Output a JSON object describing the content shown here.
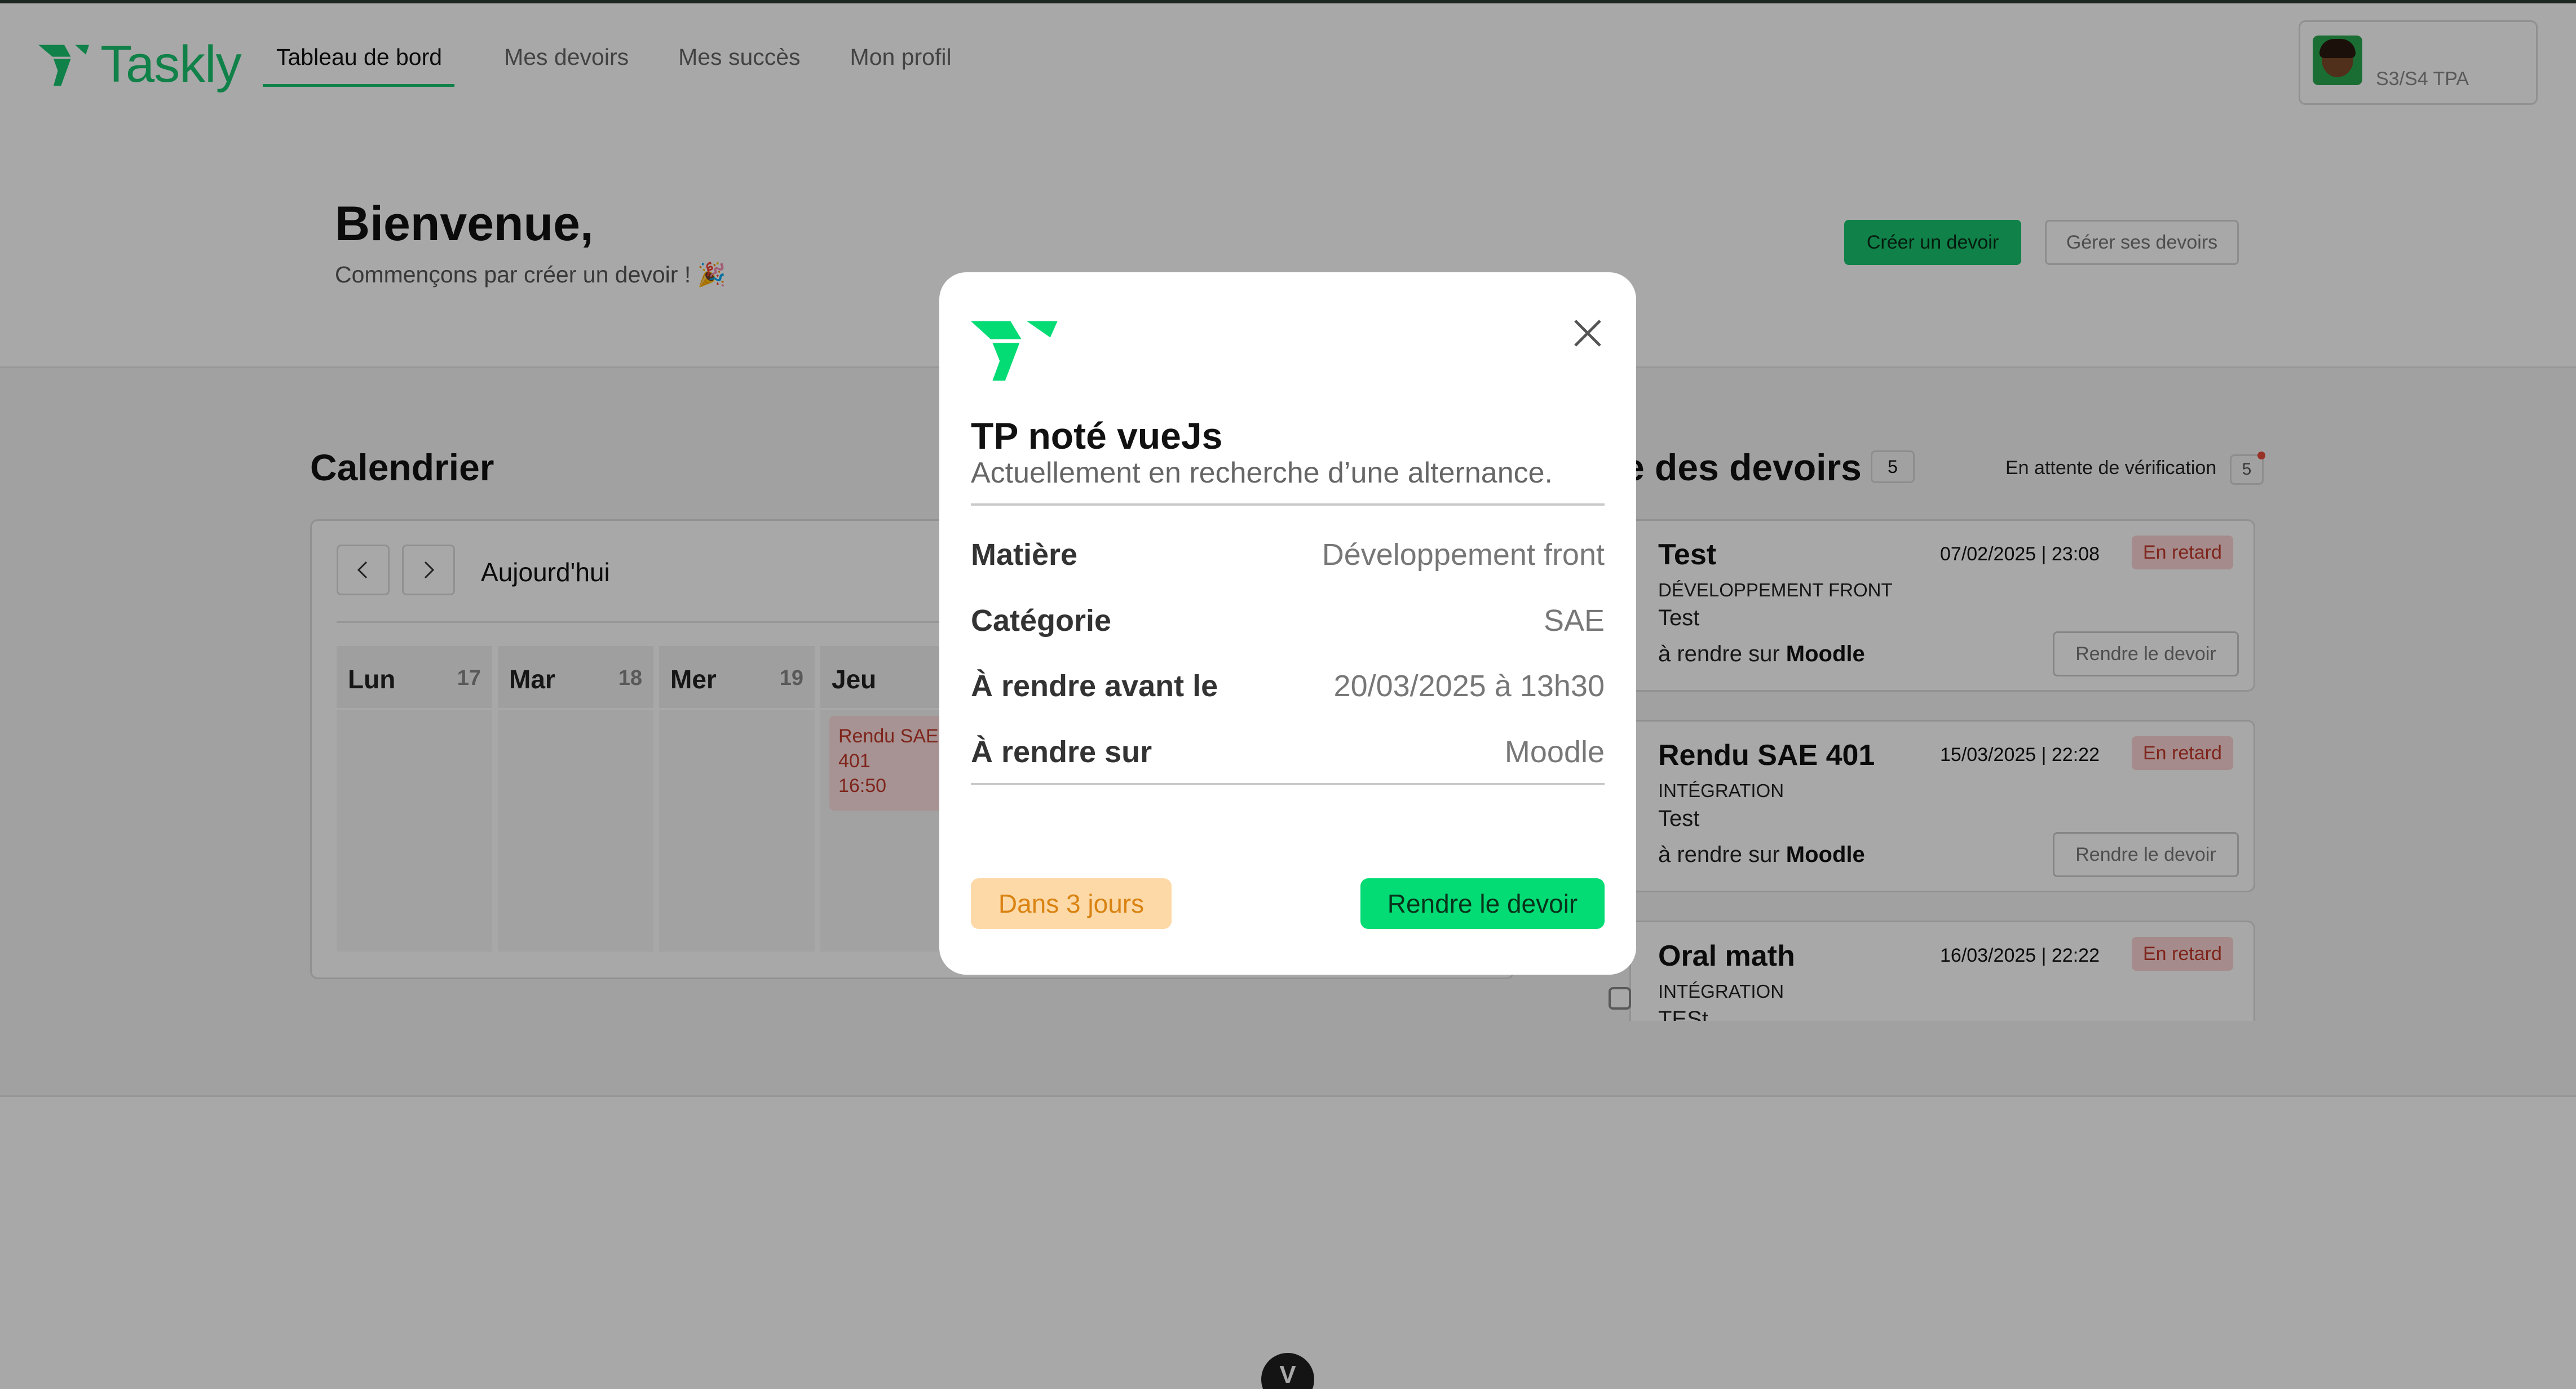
{
  "brand": {
    "name": "Taskly",
    "color": "#19c46e"
  },
  "nav": {
    "items": [
      "Tableau de bord",
      "Mes devoirs",
      "Mes succès",
      "Mon profil"
    ]
  },
  "user": {
    "class": "S3/S4 TPA"
  },
  "hero": {
    "title": "Bienvenue,",
    "subtitle": "Commençons par créer un devoir ! 🎉",
    "create_button": "Créer un devoir",
    "manage_button": "Gérer ses devoirs"
  },
  "calendar": {
    "title": "Calendrier",
    "today_button": "Aujourd'hui",
    "days": [
      {
        "name": "Lun",
        "num": "17"
      },
      {
        "name": "Mar",
        "num": "18"
      },
      {
        "name": "Mer",
        "num": "19"
      },
      {
        "name": "Jeu",
        "num": ""
      }
    ],
    "event": {
      "line1": "Rendu SAE",
      "line2": "401",
      "line3": "16:50"
    }
  },
  "task_list": {
    "title": "e des devoirs",
    "count": "5",
    "pending_label": "En attente de vérification",
    "pending_count": "5",
    "late_label": "En retard",
    "submit_label": "Rendre le devoir",
    "where_prefix": "à rendre sur",
    "tasks": [
      {
        "title": "Test",
        "date": "07/02/2025 | 23:08",
        "subject": "DÉVELOPPEMENT FRONT",
        "category": "Test",
        "platform": "Moodle"
      },
      {
        "title": "Rendu SAE 401",
        "date": "15/03/2025 | 22:22",
        "subject": "INTÉGRATION",
        "category": "Test",
        "platform": "Moodle"
      },
      {
        "title": "Oral math",
        "date": "16/03/2025 | 22:22",
        "subject": "INTÉGRATION",
        "category": "TESt",
        "platform": ""
      }
    ]
  },
  "modal": {
    "title": "TP noté vueJs",
    "description": "Actuellement en recherche d’une alternance.",
    "rows": [
      {
        "label": "Matière",
        "value": "Développement front"
      },
      {
        "label": "Catégorie",
        "value": "SAE"
      },
      {
        "label": "À rendre avant le",
        "value": "20/03/2025 à 13h30"
      },
      {
        "label": "À rendre sur",
        "value": "Moodle"
      }
    ],
    "due_badge": "Dans 3 jours",
    "submit_button": "Rendre le devoir"
  },
  "vue_badge": "V"
}
